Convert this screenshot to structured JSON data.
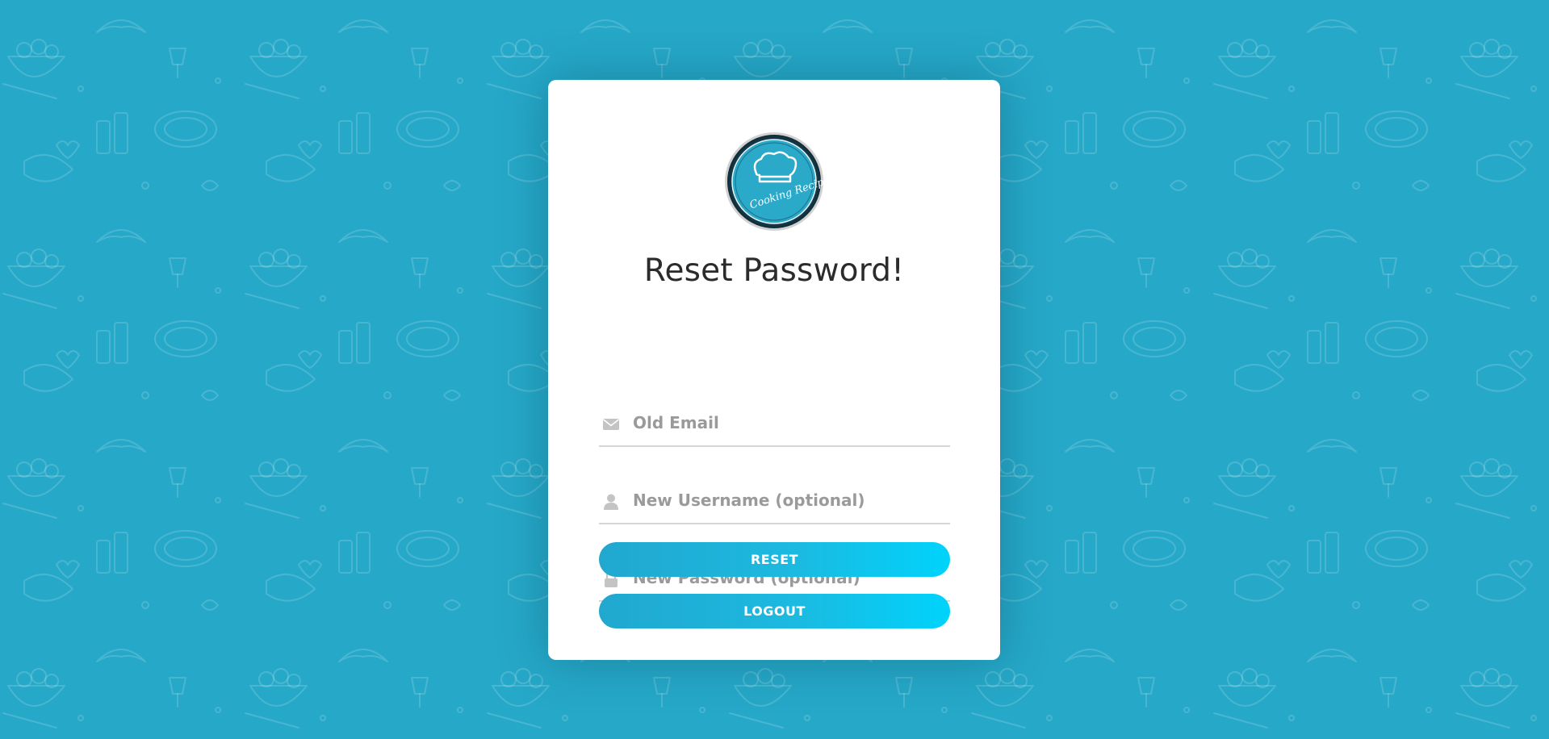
{
  "page": {
    "background_color": "#26a8c8"
  },
  "logo": {
    "text": "Cooking Recipe",
    "icon": "chef-hat-icon",
    "ring_color": "#1f4f63",
    "fill_color": "#2aa9c9"
  },
  "form": {
    "title": "Reset Password!",
    "fields": [
      {
        "name": "old-email",
        "placeholder": "Old Email",
        "value": "",
        "icon": "envelope-icon",
        "type": "email"
      },
      {
        "name": "new-username",
        "placeholder": "New Username (optional)",
        "value": "",
        "icon": "user-icon",
        "type": "text"
      },
      {
        "name": "new-password",
        "placeholder": "New Password (optional)",
        "value": "",
        "icon": "lock-icon",
        "type": "password"
      }
    ],
    "reset_label": "RESET",
    "logout_label": "LOGOUT",
    "accent_color": "#00d3fb",
    "icon_color": "#c4c4c4"
  }
}
